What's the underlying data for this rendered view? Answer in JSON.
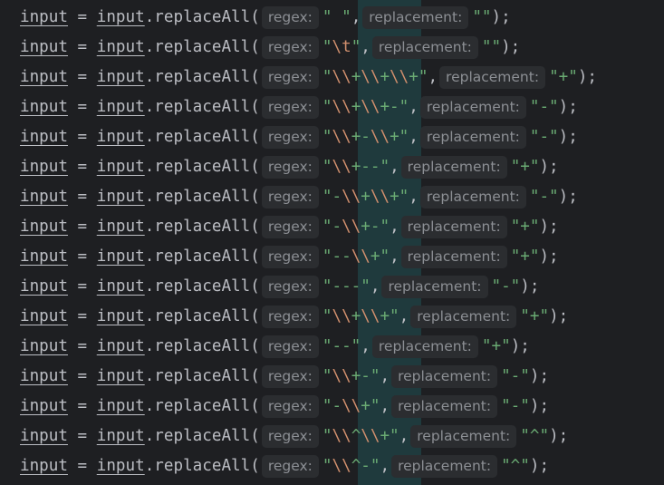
{
  "editor": {
    "colors": {
      "background": "#1e1f22",
      "text": "#bcbec4",
      "string": "#6aab73",
      "escape": "#cf8e6d",
      "hint_bg": "#2b2d30",
      "hint_text": "#8c8f94",
      "column_highlight": "#1f3a3d"
    },
    "lines": [
      {
        "variable": "input",
        "assign": " = ",
        "receiver": "input",
        "call": ".replaceAll(",
        "regex_hint": "regex:",
        "regex": "\" \"",
        "comma": ",",
        "replacement_hint": "replacement:",
        "replacement": "\"\"",
        "end": ");"
      },
      {
        "variable": "input",
        "assign": " = ",
        "receiver": "input",
        "call": ".replaceAll(",
        "regex_hint": "regex:",
        "regex": "\"\\t\"",
        "comma": ",",
        "replacement_hint": "replacement:",
        "replacement": "\"\"",
        "end": ");"
      },
      {
        "variable": "input",
        "assign": " = ",
        "receiver": "input",
        "call": ".replaceAll(",
        "regex_hint": "regex:",
        "regex": "\"\\\\+\\\\+\\\\+\"",
        "comma": ",",
        "replacement_hint": "replacement:",
        "replacement": "\"+\"",
        "end": ");"
      },
      {
        "variable": "input",
        "assign": " = ",
        "receiver": "input",
        "call": ".replaceAll(",
        "regex_hint": "regex:",
        "regex": "\"\\\\+\\\\+-\"",
        "comma": ",",
        "replacement_hint": "replacement:",
        "replacement": "\"-\"",
        "end": ");"
      },
      {
        "variable": "input",
        "assign": " = ",
        "receiver": "input",
        "call": ".replaceAll(",
        "regex_hint": "regex:",
        "regex": "\"\\\\+-\\\\+\"",
        "comma": ",",
        "replacement_hint": "replacement:",
        "replacement": "\"-\"",
        "end": ");"
      },
      {
        "variable": "input",
        "assign": " = ",
        "receiver": "input",
        "call": ".replaceAll(",
        "regex_hint": "regex:",
        "regex": "\"\\\\+--\"",
        "comma": ",",
        "replacement_hint": "replacement:",
        "replacement": "\"+\"",
        "end": ");"
      },
      {
        "variable": "input",
        "assign": " = ",
        "receiver": "input",
        "call": ".replaceAll(",
        "regex_hint": "regex:",
        "regex": "\"-\\\\+\\\\+\"",
        "comma": ",",
        "replacement_hint": "replacement:",
        "replacement": "\"-\"",
        "end": ");"
      },
      {
        "variable": "input",
        "assign": " = ",
        "receiver": "input",
        "call": ".replaceAll(",
        "regex_hint": "regex:",
        "regex": "\"-\\\\+-\"",
        "comma": ",",
        "replacement_hint": "replacement:",
        "replacement": "\"+\"",
        "end": ");"
      },
      {
        "variable": "input",
        "assign": " = ",
        "receiver": "input",
        "call": ".replaceAll(",
        "regex_hint": "regex:",
        "regex": "\"--\\\\+\"",
        "comma": ",",
        "replacement_hint": "replacement:",
        "replacement": "\"+\"",
        "end": ");"
      },
      {
        "variable": "input",
        "assign": " = ",
        "receiver": "input",
        "call": ".replaceAll(",
        "regex_hint": "regex:",
        "regex": "\"---\"",
        "comma": ",",
        "replacement_hint": "replacement:",
        "replacement": "\"-\"",
        "end": ");"
      },
      {
        "variable": "input",
        "assign": " = ",
        "receiver": "input",
        "call": ".replaceAll(",
        "regex_hint": "regex:",
        "regex": "\"\\\\+\\\\+\"",
        "comma": ",",
        "replacement_hint": "replacement:",
        "replacement": "\"+\"",
        "end": ");"
      },
      {
        "variable": "input",
        "assign": " = ",
        "receiver": "input",
        "call": ".replaceAll(",
        "regex_hint": "regex:",
        "regex": "\"--\"",
        "comma": ",",
        "replacement_hint": "replacement:",
        "replacement": "\"+\"",
        "end": ");"
      },
      {
        "variable": "input",
        "assign": " = ",
        "receiver": "input",
        "call": ".replaceAll(",
        "regex_hint": "regex:",
        "regex": "\"\\\\+-\"",
        "comma": ",",
        "replacement_hint": "replacement:",
        "replacement": "\"-\"",
        "end": ");"
      },
      {
        "variable": "input",
        "assign": " = ",
        "receiver": "input",
        "call": ".replaceAll(",
        "regex_hint": "regex:",
        "regex": "\"-\\\\+\"",
        "comma": ",",
        "replacement_hint": "replacement:",
        "replacement": "\"-\"",
        "end": ");"
      },
      {
        "variable": "input",
        "assign": " = ",
        "receiver": "input",
        "call": ".replaceAll(",
        "regex_hint": "regex:",
        "regex": "\"\\\\^\\\\+\"",
        "comma": ",",
        "replacement_hint": "replacement:",
        "replacement": "\"^\"",
        "end": ");"
      },
      {
        "variable": "input",
        "assign": " = ",
        "receiver": "input",
        "call": ".replaceAll(",
        "regex_hint": "regex:",
        "regex": "\"\\\\^-\"",
        "comma": ",",
        "replacement_hint": "replacement:",
        "replacement": "\"^\"",
        "end": ");"
      }
    ]
  }
}
